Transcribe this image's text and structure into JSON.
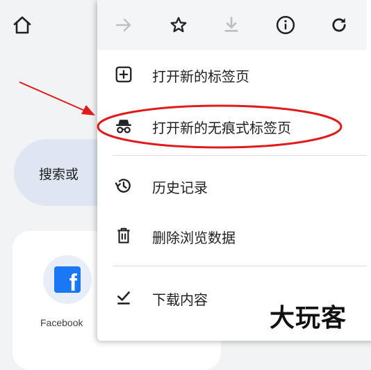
{
  "page": {
    "search_placeholder": "搜索或",
    "shortcut": {
      "label": "Facebook",
      "icon": "facebook-icon",
      "brand_color": "#1877f2"
    }
  },
  "toolbar": {
    "forward": {
      "icon": "arrow-right-icon",
      "enabled": false
    },
    "bookmark": {
      "icon": "star-outline-icon"
    },
    "download": {
      "icon": "download-icon",
      "enabled": false
    },
    "info": {
      "icon": "info-icon"
    },
    "refresh": {
      "icon": "refresh-icon"
    }
  },
  "menu": {
    "items": [
      {
        "label": "打开新的标签页",
        "icon": "new-tab-icon"
      },
      {
        "label": "打开新的无痕式标签页",
        "icon": "incognito-icon",
        "highlighted": true
      },
      {
        "label": "历史记录",
        "icon": "history-icon"
      },
      {
        "label": "删除浏览数据",
        "icon": "trash-icon"
      },
      {
        "label": "下载内容",
        "icon": "download-done-icon"
      }
    ]
  },
  "annotation": {
    "color": "#e01b1b",
    "watermark": "大玩客"
  }
}
